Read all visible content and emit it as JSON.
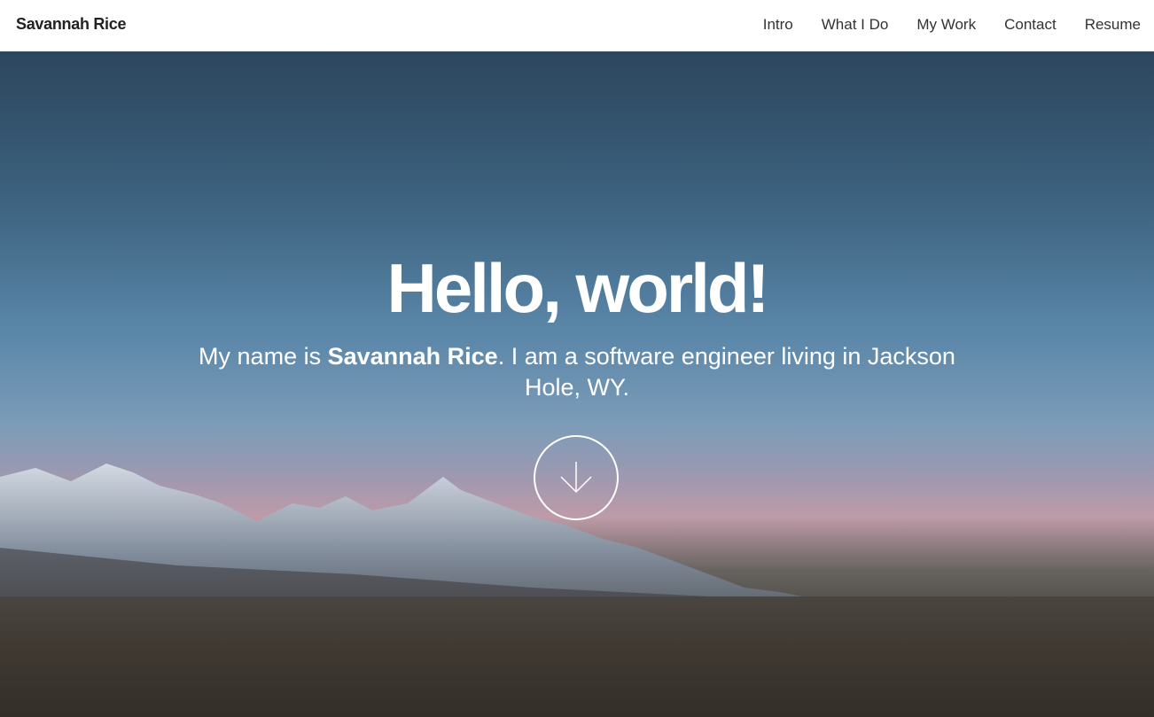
{
  "header": {
    "logo": "Savannah Rice",
    "nav": [
      {
        "label": "Intro"
      },
      {
        "label": "What I Do"
      },
      {
        "label": "My Work"
      },
      {
        "label": "Contact"
      },
      {
        "label": "Resume"
      }
    ]
  },
  "hero": {
    "title": "Hello, world!",
    "subtitle_prefix": "My name is ",
    "subtitle_name": "Savannah Rice",
    "subtitle_suffix": ". I am a software engineer living in Jackson Hole, WY.",
    "scroll_icon": "arrow-down-icon"
  },
  "colors": {
    "header_bg": "#ffffff",
    "text_dark": "#333333",
    "hero_text": "#ffffff"
  }
}
